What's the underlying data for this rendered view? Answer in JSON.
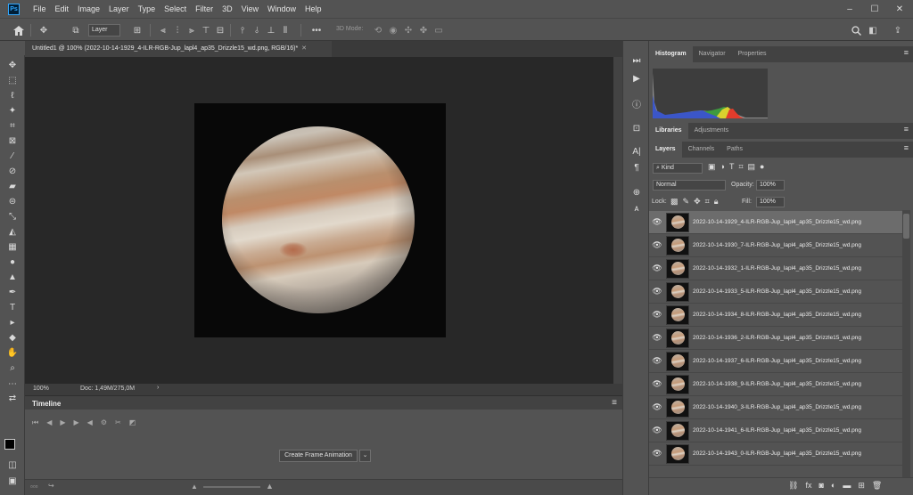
{
  "app": {
    "logo": "Ps"
  },
  "menu": [
    "File",
    "Edit",
    "Image",
    "Layer",
    "Type",
    "Select",
    "Filter",
    "3D",
    "View",
    "Window",
    "Help"
  ],
  "window_controls": {
    "minimize": "–",
    "maximize": "☐",
    "close": "✕"
  },
  "options_bar": {
    "layer_select": "Layer",
    "mode_3d": "3D Mode:",
    "more": "•••"
  },
  "document": {
    "tab_title": "Untitled1 @ 100% (2022-10-14-1929_4-ILR-RGB-Jup_lapl4_ap35_Drizzle15_wd.png, RGB/16)*",
    "tab_close": "✕",
    "zoom": "100%",
    "doc_info": "Doc: 1,49M/275,0M",
    "status_arrow": "›"
  },
  "timeline": {
    "title": "Timeline",
    "create_button": "Create Frame Animation",
    "dropdown": "⌄",
    "menu": "≡"
  },
  "panels": {
    "top_tabs": [
      "Histogram",
      "Navigator",
      "Properties"
    ],
    "mid_tabs": [
      "Libraries",
      "Adjustments"
    ],
    "layers_tabs": [
      "Layers",
      "Channels",
      "Paths"
    ],
    "menu": "≡",
    "filter_kind": "Kind",
    "blend_mode": "Normal",
    "opacity_label": "Opacity:",
    "opacity_value": "100%",
    "lock_label": "Lock:",
    "fill_label": "Fill:",
    "fill_value": "100%"
  },
  "layers": [
    {
      "name": "2022-10-14-1929_4-ILR-RGB-Jup_lapl4_ap35_Drizzle15_wd.png",
      "selected": true
    },
    {
      "name": "2022-10-14-1930_7-ILR-RGB-Jup_lapl4_ap35_Drizzle15_wd.png",
      "selected": false
    },
    {
      "name": "2022-10-14-1932_1-ILR-RGB-Jup_lapl4_ap35_Drizzle15_wd.png",
      "selected": false
    },
    {
      "name": "2022-10-14-1933_5-ILR-RGB-Jup_lapl4_ap35_Drizzle15_wd.png",
      "selected": false
    },
    {
      "name": "2022-10-14-1934_8-ILR-RGB-Jup_lapl4_ap35_Drizzle15_wd.png",
      "selected": false
    },
    {
      "name": "2022-10-14-1936_2-ILR-RGB-Jup_lapl4_ap35_Drizzle15_wd.png",
      "selected": false
    },
    {
      "name": "2022-10-14-1937_6-ILR-RGB-Jup_lapl4_ap35_Drizzle15_wd.png",
      "selected": false
    },
    {
      "name": "2022-10-14-1938_9-ILR-RGB-Jup_lapl4_ap35_Drizzle15_wd.png",
      "selected": false
    },
    {
      "name": "2022-10-14-1940_3-ILR-RGB-Jup_lapl4_ap35_Drizzle15_wd.png",
      "selected": false
    },
    {
      "name": "2022-10-14-1941_6-ILR-RGB-Jup_lapl4_ap35_Drizzle15_wd.png",
      "selected": false
    },
    {
      "name": "2022-10-14-1943_0-ILR-RGB-Jup_lapl4_ap35_Drizzle15_wd.png",
      "selected": false
    }
  ],
  "colors": {
    "accent": "#31a8ff",
    "canvas_bg": "#282828",
    "panel_bg": "#535353"
  }
}
